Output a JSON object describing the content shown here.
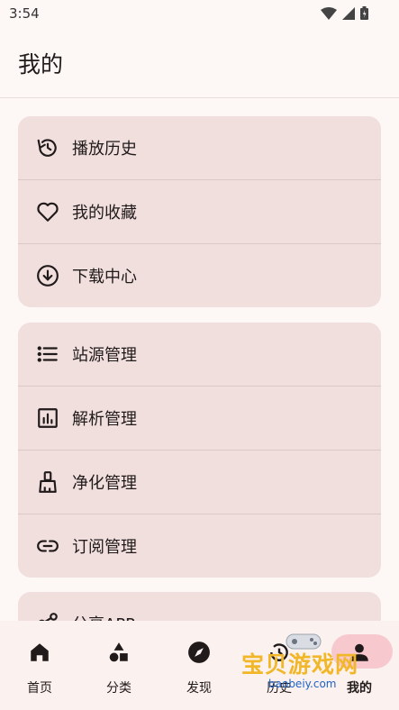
{
  "status": {
    "time": "3:54"
  },
  "header": {
    "title": "我的"
  },
  "groups": [
    {
      "items": [
        {
          "label": "播放历史",
          "icon": "history-icon"
        },
        {
          "label": "我的收藏",
          "icon": "heart-icon"
        },
        {
          "label": "下载中心",
          "icon": "download-icon"
        }
      ]
    },
    {
      "items": [
        {
          "label": "站源管理",
          "icon": "list-icon"
        },
        {
          "label": "解析管理",
          "icon": "analytics-icon"
        },
        {
          "label": "净化管理",
          "icon": "broom-icon"
        },
        {
          "label": "订阅管理",
          "icon": "link-icon"
        }
      ]
    },
    {
      "items": [
        {
          "label": "分享APP",
          "icon": "share-icon"
        }
      ]
    }
  ],
  "nav": [
    {
      "label": "首页",
      "icon": "home-icon"
    },
    {
      "label": "分类",
      "icon": "category-icon"
    },
    {
      "label": "发现",
      "icon": "compass-icon"
    },
    {
      "label": "历史",
      "icon": "history-icon"
    },
    {
      "label": "我的",
      "icon": "person-icon",
      "selected": true
    }
  ],
  "watermark": {
    "text": "宝贝游戏网",
    "sub": "baobeiy.com"
  },
  "colors": {
    "background": "#fdf7f6",
    "card": "#f0dfdd",
    "nav_selected": "#f7c9cf"
  }
}
